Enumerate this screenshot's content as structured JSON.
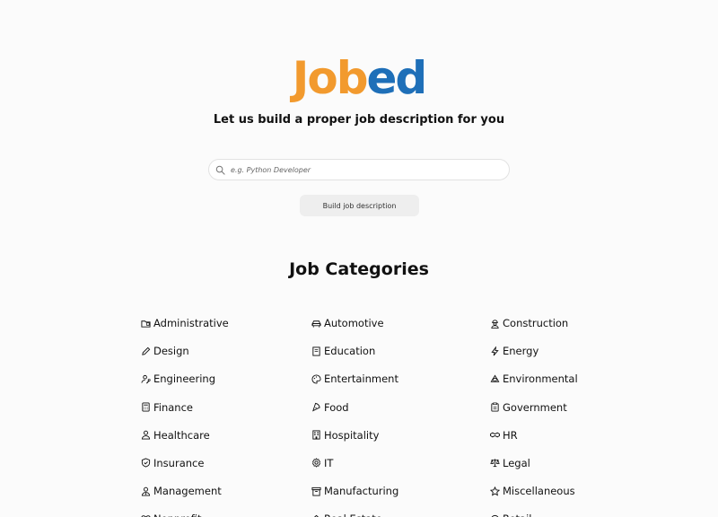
{
  "logo": {
    "part1": "Job",
    "part2": "ed"
  },
  "tagline": "Let us build a proper job description for you",
  "search": {
    "placeholder": "e.g. Python Developer",
    "value": ""
  },
  "build_button": "Build job description",
  "categories_title": "Job Categories",
  "categories": [
    {
      "label": "Administrative",
      "icon": "folder-icon"
    },
    {
      "label": "Automotive",
      "icon": "car-icon"
    },
    {
      "label": "Construction",
      "icon": "worker-icon"
    },
    {
      "label": "Design",
      "icon": "pencil-icon"
    },
    {
      "label": "Education",
      "icon": "book-icon"
    },
    {
      "label": "Energy",
      "icon": "lightning-icon"
    },
    {
      "label": "Engineering",
      "icon": "engineer-icon"
    },
    {
      "label": "Entertainment",
      "icon": "palette-icon"
    },
    {
      "label": "Environmental",
      "icon": "recycle-icon"
    },
    {
      "label": "Finance",
      "icon": "calculator-icon"
    },
    {
      "label": "Food",
      "icon": "pizza-icon"
    },
    {
      "label": "Government",
      "icon": "clipboard-icon"
    },
    {
      "label": "Healthcare",
      "icon": "doctor-icon"
    },
    {
      "label": "Hospitality",
      "icon": "hotel-icon"
    },
    {
      "label": "HR",
      "icon": "handshake-icon"
    },
    {
      "label": "Insurance",
      "icon": "shield-icon"
    },
    {
      "label": "IT",
      "icon": "gear-icon"
    },
    {
      "label": "Legal",
      "icon": "scale-icon"
    },
    {
      "label": "Management",
      "icon": "manager-icon"
    },
    {
      "label": "Manufacturing",
      "icon": "box-icon"
    },
    {
      "label": "Miscellaneous",
      "icon": "star-icon"
    },
    {
      "label": "Nonprofit",
      "icon": "heart-icon"
    },
    {
      "label": "Real Estate",
      "icon": "house-icon"
    },
    {
      "label": "Retail",
      "icon": "tag-icon"
    }
  ]
}
